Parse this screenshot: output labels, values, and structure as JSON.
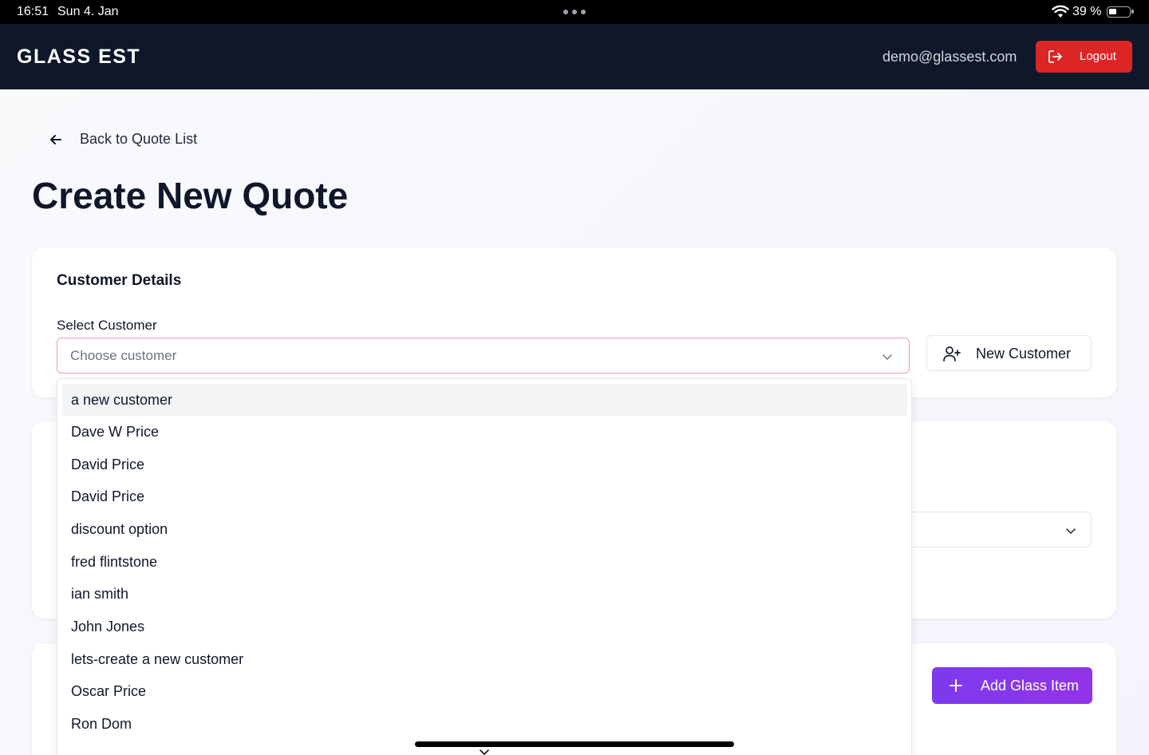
{
  "status_bar": {
    "time": "16:51",
    "date": "Sun 4. Jan",
    "battery": "39 %"
  },
  "header": {
    "brand": "GLASS EST",
    "user_email": "demo@glassest.com",
    "logout_label": "Logout"
  },
  "nav": {
    "back_label": "Back to Quote List"
  },
  "page": {
    "title": "Create New Quote"
  },
  "customer_details": {
    "title": "Customer Details",
    "select_label": "Select Customer",
    "select_placeholder": "Choose customer",
    "new_customer_label": "New Customer"
  },
  "glass_items": {
    "add_label": "Add Glass Item"
  },
  "customer_options": [
    "a new customer",
    "Dave W Price",
    "David Price",
    "David Price",
    "discount option",
    "fred flintstone",
    "ian smith",
    "John Jones",
    "lets-create a new customer",
    "Oscar Price",
    "Ron Dom"
  ],
  "colors": {
    "header_bg": "#0f172a",
    "logout_bg": "#dc2626",
    "accent_purple": "#7c3aed",
    "select_error_border": "#f09aa5"
  },
  "icons": {
    "back": "arrow-left-icon",
    "logout": "logout-icon",
    "new_customer": "user-plus-icon",
    "dropdown": "chevron-down-icon",
    "add": "plus-icon"
  }
}
